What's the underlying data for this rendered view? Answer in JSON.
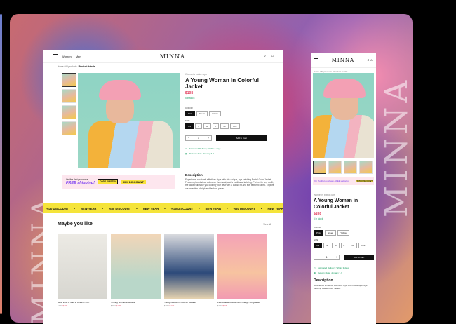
{
  "watermark": "MINNA",
  "desktop": {
    "nav": {
      "women": "Women",
      "men": "Men"
    },
    "logo": "MINNA",
    "icons": [
      "search-icon",
      "bag-icon"
    ],
    "breadcrumb": {
      "home": "Home",
      "sep1": "/",
      "category": "All products",
      "sep2": "/",
      "current": "Product details"
    },
    "product": {
      "tag": "Women's button ups",
      "title": "A Young Woman in Colorful Jacket",
      "price": "$108",
      "stock": "5 in stock",
      "color_label": "COLOR",
      "colors": [
        "Pink",
        "Green",
        "Yellow"
      ],
      "size_label": "SIZE",
      "sizes": [
        "XS",
        "S",
        "M",
        "L",
        "XL",
        "XXL"
      ],
      "qty_minus": "−",
      "qty": "1",
      "qty_plus": "+",
      "add_to_cart": "Add to Cart",
      "delivery1": "Estimated Delivery: Within 3 days",
      "delivery2": "Delivery date: January 7-9"
    },
    "promo": {
      "line1": "On the first purchase",
      "line2": "FREE shipping!",
      "code": "CODE FIRST50",
      "discount": "50% DISCOUNT"
    },
    "description": {
      "heading": "Description",
      "text": "Experience a natural, effortless style with this unique, eye-catching Pastel Color Jacket. Featuring five distinct colors on the visual, and a traditional tailoring. Perfect for any outfit, the jacket will have you looking your best with a classic fit and soft textured fabric. Explore our selection of high-end fashion pieces."
    },
    "ticker": [
      "%30 DISCOUNT",
      "•",
      "NEW YEAR",
      "•",
      "%30 DISCOUNT",
      "•",
      "NEW YEAR",
      "•",
      "%30 DISCOUNT",
      "•",
      "NEW YEAR",
      "•",
      "%30 DISCOUNT",
      "•",
      "NEW YEAR",
      "•",
      "%30 DISCOUNT"
    ],
    "maybe": {
      "heading": "Maybe you like",
      "view_all": "View all"
    },
    "cards": [
      {
        "name": "Back View of Man in White T-Shirt",
        "old": "$157",
        "price": "$140"
      },
      {
        "name": "Smiling Woman in Hoodie",
        "old": "$157",
        "price": "$140"
      },
      {
        "name": "Young Woman in Colorful Sweater",
        "old": "$157",
        "price": "$120"
      },
      {
        "name": "Fashionable Woman with Orange Sunglasses",
        "old": "$157",
        "price": "$128"
      }
    ]
  },
  "mobile": {
    "logo": "MINNA",
    "breadcrumb": "Home / All products / Product details",
    "promo_left": "On the first purchase FREE shipping!",
    "promo_right": "50% DISCOUNT",
    "tag": "Women's button ups",
    "title": "A Young Woman in Colorful Jacket",
    "price": "$108",
    "stock": "5 in stock",
    "color_label": "COLOR",
    "colors": [
      "Pink",
      "Green",
      "Yellow"
    ],
    "size_label": "SIZE",
    "sizes": [
      "XS",
      "S",
      "M",
      "L",
      "XL",
      "XXL"
    ],
    "qty": "1",
    "add_to_cart": "Add to Cart",
    "delivery1": "Estimated Delivery: Within 3 days",
    "delivery2": "Delivery date: January 7-9",
    "desc_heading": "Description",
    "desc_text": "Experience a natural, effortless style with this unique, eye-catching Pastel Color Jacket."
  }
}
